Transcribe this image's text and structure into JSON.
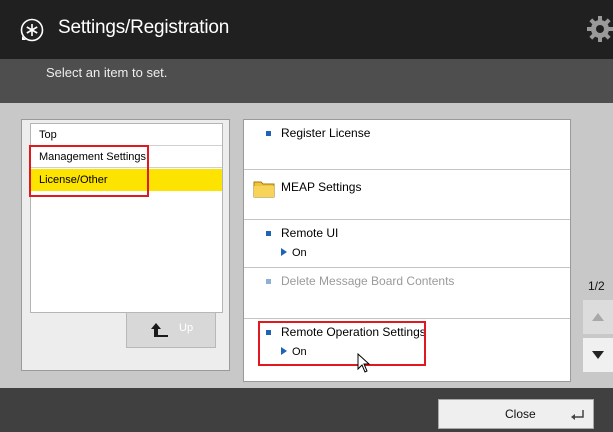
{
  "header": {
    "title": "Settings/Registration",
    "app_icon": "settings-registration-icon",
    "right_icon": "gear-icon"
  },
  "subheader": {
    "instruction": "Select an item to set."
  },
  "tree": {
    "items": [
      {
        "label": "Top",
        "selected": false
      },
      {
        "label": "Management Settings",
        "selected": false
      },
      {
        "label": "License/Other",
        "selected": true
      }
    ],
    "up_button": "Up"
  },
  "list": {
    "items": [
      {
        "label": "Register License",
        "icon": "bullet",
        "enabled": true
      },
      {
        "label": "MEAP Settings",
        "icon": "folder-icon",
        "enabled": true
      },
      {
        "label": "Remote UI",
        "icon": "bullet",
        "enabled": true,
        "value": "On"
      },
      {
        "label": "Delete Message Board Contents",
        "icon": "bullet",
        "enabled": false
      },
      {
        "label": "Remote Operation Settings",
        "icon": "bullet",
        "enabled": true,
        "value": "On"
      }
    ]
  },
  "pager": {
    "indicator": "1/2"
  },
  "footer": {
    "close": "Close"
  },
  "colors": {
    "selected": "#fde300",
    "highlight": "#e0181f",
    "bullet": "#1f63b6",
    "titlebar": "#202020"
  }
}
